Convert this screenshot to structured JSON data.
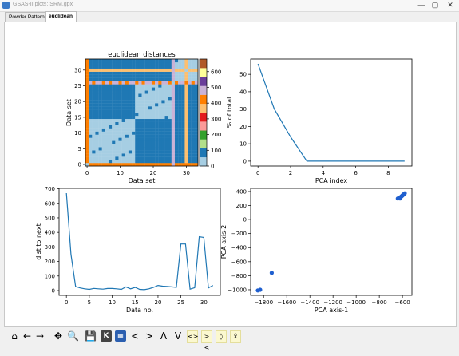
{
  "window": {
    "title": "GSAS-II plots: SRM.gpx",
    "min_label": "—",
    "max_label": "▢",
    "close_label": "✕"
  },
  "tabs": [
    {
      "label": "Powder Patterns"
    },
    {
      "label": "euclidean"
    }
  ],
  "toolbar": {
    "icons": [
      {
        "name": "home-icon",
        "glyph": "⌂"
      },
      {
        "name": "back-icon",
        "glyph": "←"
      },
      {
        "name": "forward-icon",
        "glyph": "→"
      },
      {
        "name": "pan-icon",
        "glyph": "✥"
      },
      {
        "name": "zoom-icon",
        "glyph": "🔍"
      },
      {
        "name": "save-icon",
        "glyph": "💾"
      },
      {
        "name": "k-icon",
        "glyph": "K"
      },
      {
        "name": "image-icon",
        "glyph": "▦"
      },
      {
        "name": "shift-left-icon",
        "glyph": "<"
      },
      {
        "name": "shift-right-icon",
        "glyph": ">"
      },
      {
        "name": "shift-up-icon",
        "glyph": "Λ"
      },
      {
        "name": "shift-down-icon",
        "glyph": "V"
      },
      {
        "name": "expand-x-icon",
        "glyph": "<>"
      },
      {
        "name": "shrink-x-icon",
        "glyph": "><"
      },
      {
        "name": "expand-y-icon",
        "glyph": "◊"
      },
      {
        "name": "shrink-y-icon",
        "glyph": "x̂"
      }
    ]
  },
  "chart_data": [
    {
      "type": "heatmap",
      "title": "euclidean distances",
      "xlabel": "Data set",
      "ylabel": "Data set",
      "size": 34,
      "x_ticks": [
        0,
        10,
        20,
        30
      ],
      "y_ticks": [
        0,
        5,
        10,
        15,
        20,
        25,
        30
      ],
      "colorbar_ticks": [
        0,
        100,
        200,
        300,
        400,
        500,
        600
      ],
      "colorbar_range": [
        0,
        680
      ],
      "colormap": "Paired",
      "outlier_sets": [
        0,
        26,
        30
      ],
      "cluster_blocks": [
        [
          0,
          14
        ],
        [
          15,
          26
        ],
        [
          27,
          33
        ]
      ]
    },
    {
      "type": "line",
      "title": "",
      "xlabel": "PCA index",
      "ylabel": "% of total",
      "x": [
        0,
        1,
        2,
        3,
        4,
        5,
        6,
        7,
        8,
        9
      ],
      "y": [
        56,
        30,
        14,
        0,
        0,
        0,
        0,
        0,
        0,
        0
      ],
      "xlim": [
        -0.45,
        9.45
      ],
      "ylim": [
        -2.8,
        58.8
      ],
      "x_ticks": [
        0,
        2,
        4,
        6,
        8
      ],
      "y_ticks": [
        0,
        10,
        20,
        30,
        40,
        50
      ],
      "color": "#1f77b4"
    },
    {
      "type": "line",
      "title": "",
      "xlabel": "Data no.",
      "ylabel": "dist to next",
      "x": [
        0,
        1,
        2,
        3,
        4,
        5,
        6,
        7,
        8,
        9,
        10,
        11,
        12,
        13,
        14,
        15,
        16,
        17,
        18,
        19,
        20,
        21,
        22,
        23,
        24,
        25,
        26,
        27,
        28,
        29,
        30,
        31,
        32
      ],
      "y": [
        670,
        250,
        28,
        18,
        12,
        8,
        15,
        12,
        10,
        14,
        14,
        12,
        8,
        25,
        12,
        22,
        8,
        6,
        12,
        22,
        35,
        30,
        28,
        25,
        22,
        320,
        320,
        10,
        20,
        370,
        365,
        18,
        35
      ],
      "xlim": [
        -1.6,
        33.6
      ],
      "ylim": [
        -33,
        703
      ],
      "x_ticks": [
        0,
        5,
        10,
        15,
        20,
        25,
        30
      ],
      "y_ticks": [
        0,
        100,
        200,
        300,
        400,
        500,
        600,
        700
      ],
      "color": "#1f77b4"
    },
    {
      "type": "scatter",
      "title": "",
      "xlabel": "PCA axis-1",
      "ylabel": "PCA axis-2",
      "x": [
        -1850,
        -1830,
        -1730,
        -640,
        -630,
        -620,
        -615,
        -610,
        -605,
        -600,
        -595,
        -590,
        -585,
        -580
      ],
      "y": [
        -1010,
        -1000,
        -760,
        300,
        305,
        300,
        320,
        330,
        335,
        345,
        350,
        360,
        365,
        375
      ],
      "xlim": [
        -1912,
        -518
      ],
      "ylim": [
        -1080,
        445
      ],
      "x_ticks": [
        -1800,
        -1600,
        -1400,
        -1200,
        -1000,
        -800,
        -600
      ],
      "y_ticks": [
        -1000,
        -800,
        -600,
        -400,
        -200,
        0,
        200,
        400
      ],
      "color": "#1f5fcf"
    }
  ]
}
